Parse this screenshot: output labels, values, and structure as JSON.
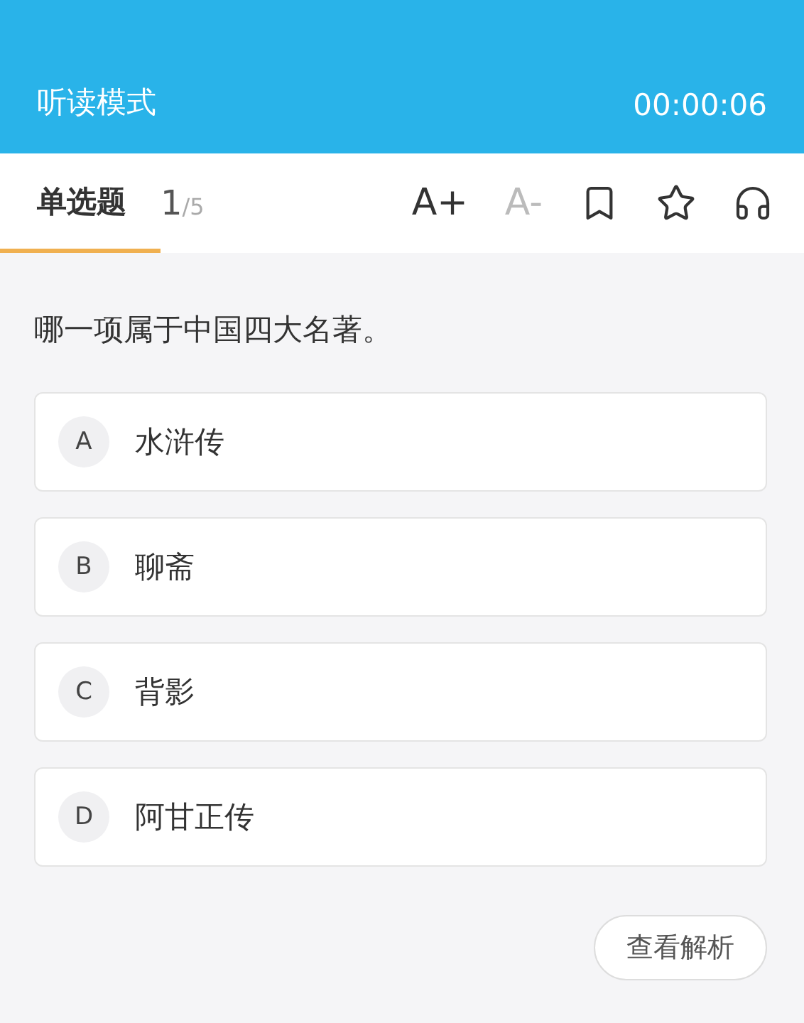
{
  "header": {
    "title": "听读模式",
    "timer": "00:00:06"
  },
  "tabs": [
    {
      "label": "单选题",
      "selected": true
    }
  ],
  "progress": {
    "current": "1",
    "total": "/5"
  },
  "toolbar": [
    {
      "kind": "text",
      "label": "A+",
      "disabled": false
    },
    {
      "kind": "text",
      "label": "A-",
      "disabled": true
    },
    {
      "kind": "bookmark",
      "disabled": false
    },
    {
      "kind": "star",
      "disabled": false
    },
    {
      "kind": "headphones",
      "disabled": false
    }
  ],
  "question": "哪一项属于中国四大名著。",
  "options": [
    {
      "letter": "A",
      "text": "水浒传",
      "selected": false
    },
    {
      "letter": "B",
      "text": "聊斋",
      "selected": false
    },
    {
      "letter": "C",
      "text": "背影",
      "selected": false
    },
    {
      "letter": "D",
      "text": "阿甘正传",
      "selected": false
    }
  ],
  "analysis_button": "查看解析"
}
